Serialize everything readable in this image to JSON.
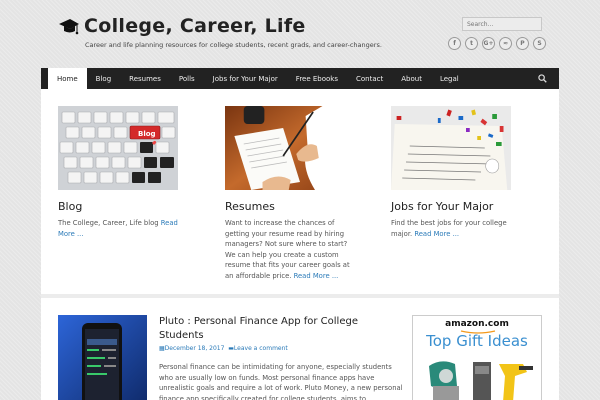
{
  "site": {
    "title": "College, Career, Life",
    "tagline": "Career and life planning resources for college students, recent grads, and career-changers."
  },
  "search": {
    "placeholder": "Search..."
  },
  "socials": [
    {
      "name": "facebook-icon",
      "glyph": "f"
    },
    {
      "name": "twitter-icon",
      "glyph": "t"
    },
    {
      "name": "google-plus-icon",
      "glyph": "G+"
    },
    {
      "name": "rss-icon",
      "glyph": "≈"
    },
    {
      "name": "pinterest-icon",
      "glyph": "P"
    },
    {
      "name": "stumbleupon-icon",
      "glyph": "S"
    }
  ],
  "nav": {
    "items": [
      "Home",
      "Blog",
      "Resumes",
      "Polls",
      "Jobs for Your Major",
      "Free Ebooks",
      "Contact",
      "About",
      "Legal"
    ],
    "active": "Home"
  },
  "features": [
    {
      "title": "Blog",
      "text": "The College, Career, Life blog ",
      "more": "Read More ...",
      "key_label": "Blog"
    },
    {
      "title": "Resumes",
      "text": "Want to increase the chances of getting your resume read by hiring managers? Not sure where to start? We can help you create a custom resume that fits your career goals at an affordable price. ",
      "more": "Read More ..."
    },
    {
      "title": "Jobs for Your Major",
      "text": "Find the best jobs for your college major. ",
      "more": "Read More ..."
    }
  ],
  "post": {
    "title": "Pluto : Personal Finance App for College Students",
    "date": "December 18, 2017",
    "comments": "Leave a comment",
    "excerpt": "Personal finance can be intimidating for anyone, especially students who are usually low on funds. Most personal finance apps have unrealistic goals and require a lot of work. Pluto Money, a new personal finance app specifically created for college students, aims to"
  },
  "ad": {
    "brand": "amazon.com",
    "title": "Top Gift Ideas"
  },
  "colors": {
    "nav_bg": "#222222",
    "link": "#2a7ab8",
    "ad_title": "#3a8fd0"
  }
}
